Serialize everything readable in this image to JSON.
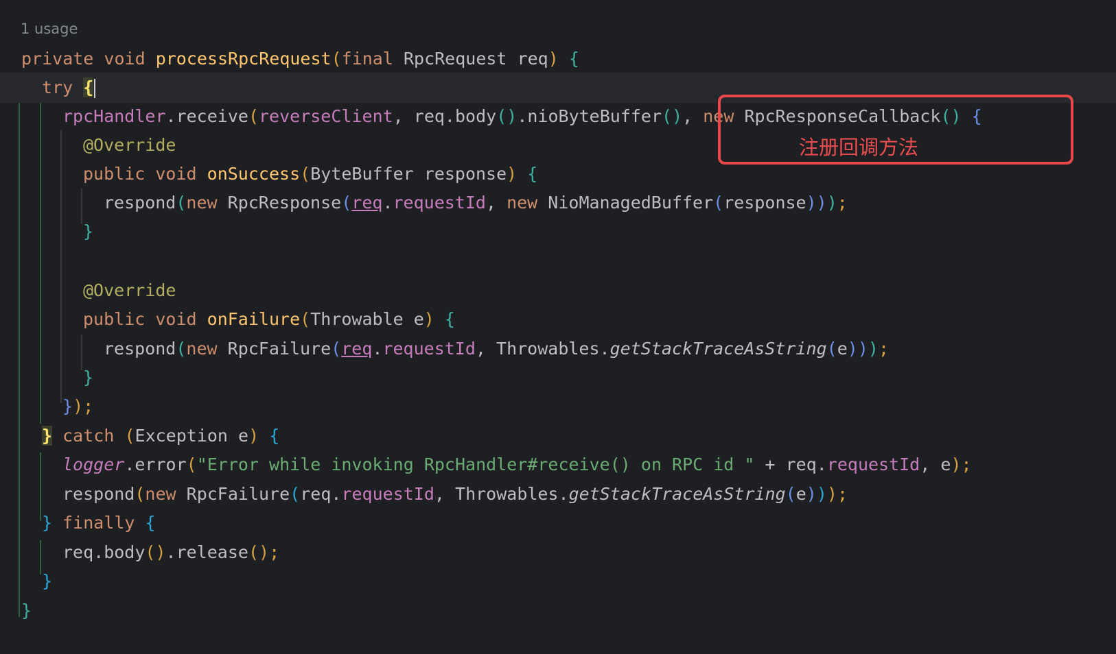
{
  "usage_hint": "1 usage",
  "annotation": {
    "label": "注册回调方法",
    "color": "#e8484a"
  },
  "colors": {
    "background": "#1e1f22",
    "keyword": "#cf8e6d",
    "method": "#ffc66d",
    "field": "#c77dbb",
    "annotation": "#b3ae60",
    "string": "#6aab73"
  },
  "code": {
    "l1": {
      "kw1": "private",
      "kw2": "void",
      "name": "processRpcRequest",
      "p1": "(",
      "kw3": "final",
      "type": "RpcRequest",
      "arg": "req",
      "p2": ")",
      "brace": "{"
    },
    "l2": {
      "kw": "try",
      "brace": "{"
    },
    "l3": {
      "fld": "rpcHandler",
      "call": ".receive",
      "p1": "(",
      "arg1": "reverseClient",
      "sep1": ", ",
      "t1": "req.body",
      "p2": "()",
      "t2": ".nioByteBuffer",
      "p3": "()",
      "sep2": ", ",
      "kw": "new",
      "type": "RpcResponseCallback",
      "p4": "()",
      "brace": "{"
    },
    "l4": {
      "ann": "@Override"
    },
    "l5": {
      "kw1": "public",
      "kw2": "void",
      "name": "onSuccess",
      "p1": "(",
      "params": "ByteBuffer response",
      "p2": ")",
      "brace": "{"
    },
    "l6": {
      "call": "respond",
      "p1": "(",
      "kw1": "new",
      "type1": "RpcResponse",
      "p2": "(",
      "var": "req",
      "dot": ".",
      "fld": "requestId",
      "sep": ", ",
      "kw2": "new",
      "type2": "NioManagedBuffer",
      "p3": "(",
      "arg": "response",
      "p4": ")",
      "p5": ")",
      "p6": ")",
      "semi": ";"
    },
    "l7": {
      "brace": "}"
    },
    "l8": {
      "ann": "@Override"
    },
    "l9": {
      "kw1": "public",
      "kw2": "void",
      "name": "onFailure",
      "p1": "(",
      "params": "Throwable e",
      "p2": ")",
      "brace": "{"
    },
    "l10": {
      "call": "respond",
      "p1": "(",
      "kw": "new",
      "type": "RpcFailure",
      "p2": "(",
      "var": "req",
      "dot": ".",
      "fld": "requestId",
      "sep": ", ",
      "cls": "Throwables.",
      "method": "getStackTraceAsString",
      "p3": "(",
      "arg": "e",
      "p4": ")",
      "p5": ")",
      "p6": ")",
      "semi": ";"
    },
    "l11": {
      "brace": "}"
    },
    "l12": {
      "close1": "}",
      "close2": ")",
      "semi": ";"
    },
    "l13": {
      "brace1": "}",
      "kw": "catch",
      "p1": "(",
      "params": "Exception e",
      "p2": ")",
      "brace2": "{"
    },
    "l14": {
      "logger": "logger",
      "call": ".error",
      "p1": "(",
      "str": "\"Error while invoking RpcHandler#receive() on RPC id \"",
      "mid": " + req.",
      "fld": "requestId",
      "tail": ", e",
      "p2": ")",
      "semi": ";"
    },
    "l15": {
      "call": "respond",
      "p1": "(",
      "kw": "new",
      "type": "RpcFailure",
      "p2": "(",
      "var": "req.",
      "fld": "requestId",
      "sep": ", ",
      "cls": "Throwables.",
      "method": "getStackTraceAsString",
      "p3": "(",
      "arg": "e",
      "p4": ")",
      "p5": ")",
      "p6": ")",
      "semi": ";"
    },
    "l16": {
      "brace1": "}",
      "kw": "finally",
      "brace2": "{"
    },
    "l17": {
      "t1": "req.body",
      "p1": "()",
      "t2": ".release",
      "p2": "()",
      "semi": ";"
    },
    "l18": {
      "brace": "}"
    },
    "l19": {
      "brace": "}"
    }
  }
}
